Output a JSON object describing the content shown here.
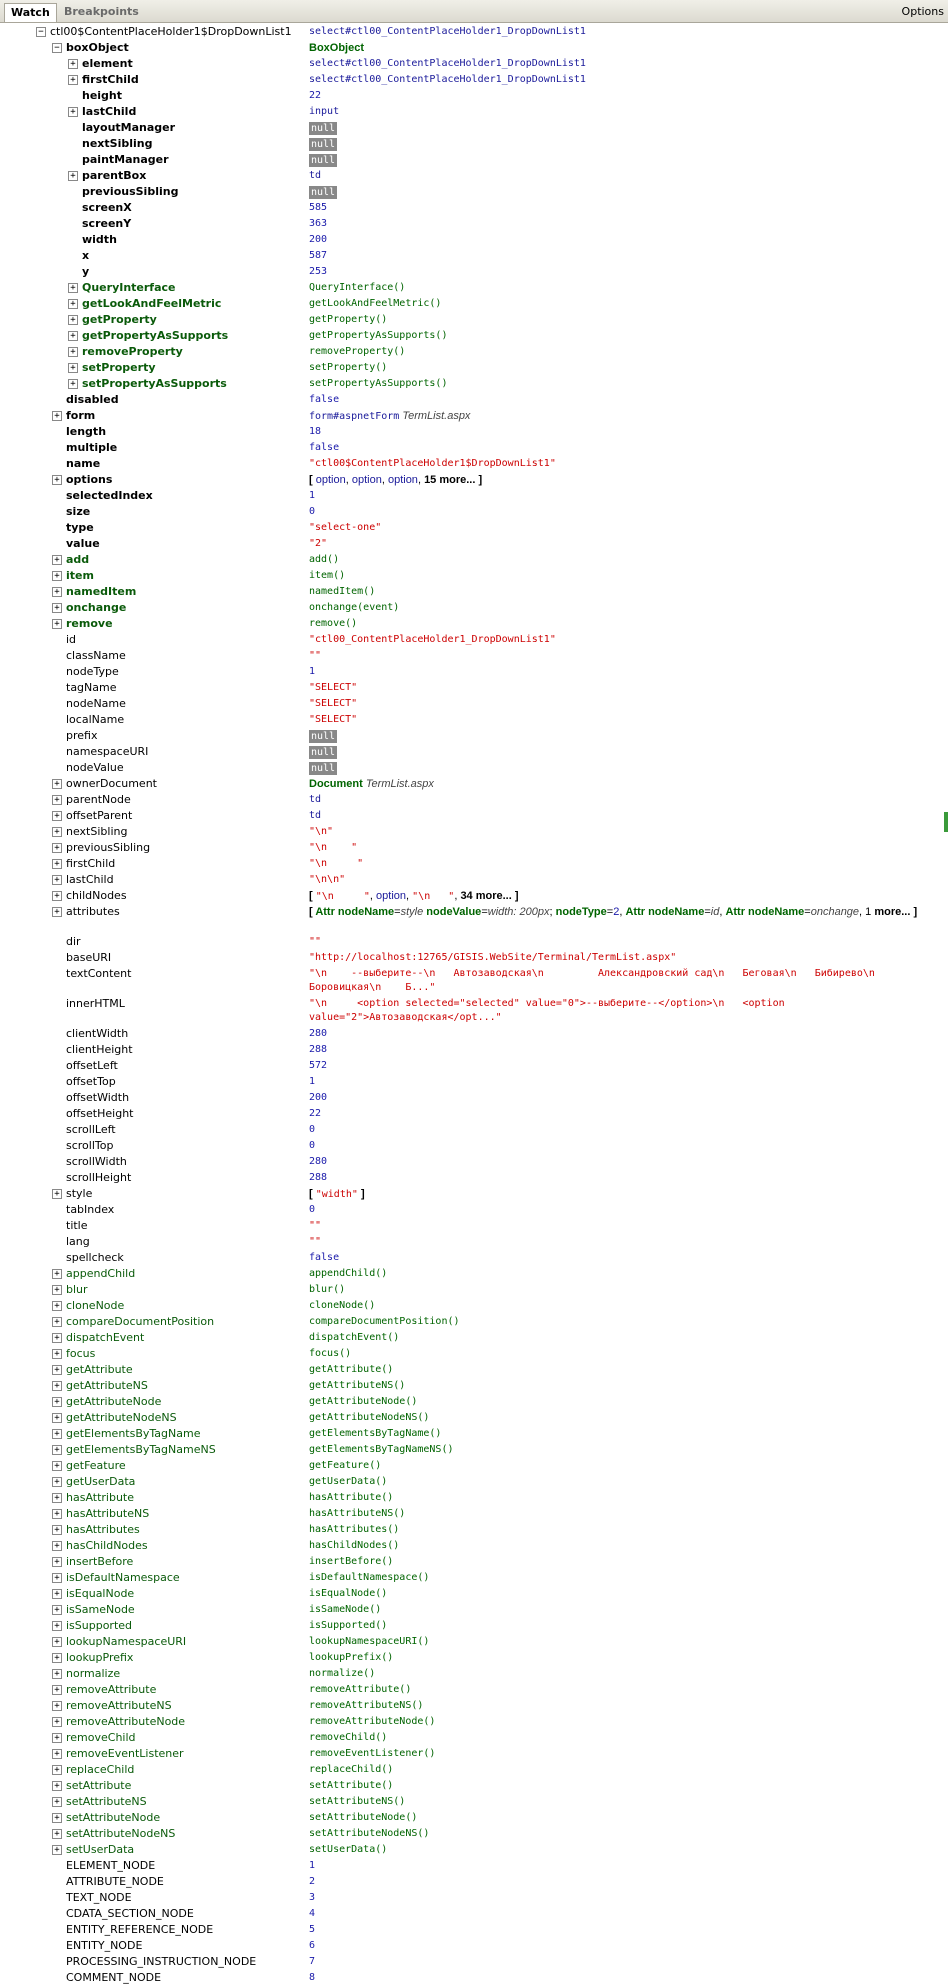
{
  "tabs": {
    "watch": "Watch",
    "breakpoints": "Breakpoints",
    "options": "Options"
  },
  "rows": [
    {
      "d": 0,
      "t": "-",
      "nc": "n-dom",
      "name": "ctl00$ContentPlaceHolder1$DropDownList1",
      "vc": "v-obj",
      "val": "select#ctl00_ContentPlaceHolder1_DropDownList1"
    },
    {
      "d": 1,
      "t": "-",
      "nc": "n-user",
      "name": "boxObject",
      "vc": "v-bold",
      "val": "BoxObject"
    },
    {
      "d": 2,
      "t": "+",
      "nc": "n-user",
      "name": "element",
      "vc": "v-obj",
      "val": "select#ctl00_ContentPlaceHolder1_DropDownList1"
    },
    {
      "d": 2,
      "t": "+",
      "nc": "n-user",
      "name": "firstChild",
      "vc": "v-obj",
      "val": "select#ctl00_ContentPlaceHolder1_DropDownList1"
    },
    {
      "d": 2,
      "t": "",
      "nc": "n-user",
      "name": "height",
      "vc": "v-num",
      "val": "22"
    },
    {
      "d": 2,
      "t": "+",
      "nc": "n-user",
      "name": "lastChild",
      "vc": "v-obj",
      "val": "input"
    },
    {
      "d": 2,
      "t": "",
      "nc": "n-user",
      "name": "layoutManager",
      "vc": "v-null",
      "val": "null"
    },
    {
      "d": 2,
      "t": "",
      "nc": "n-user",
      "name": "nextSibling",
      "vc": "v-null",
      "val": "null"
    },
    {
      "d": 2,
      "t": "",
      "nc": "n-user",
      "name": "paintManager",
      "vc": "v-null",
      "val": "null"
    },
    {
      "d": 2,
      "t": "+",
      "nc": "n-user",
      "name": "parentBox",
      "vc": "v-obj",
      "val": "td"
    },
    {
      "d": 2,
      "t": "",
      "nc": "n-user",
      "name": "previousSibling",
      "vc": "v-null",
      "val": "null"
    },
    {
      "d": 2,
      "t": "",
      "nc": "n-user",
      "name": "screenX",
      "vc": "v-num",
      "val": "585"
    },
    {
      "d": 2,
      "t": "",
      "nc": "n-user",
      "name": "screenY",
      "vc": "v-num",
      "val": "363"
    },
    {
      "d": 2,
      "t": "",
      "nc": "n-user",
      "name": "width",
      "vc": "v-num",
      "val": "200"
    },
    {
      "d": 2,
      "t": "",
      "nc": "n-user",
      "name": "x",
      "vc": "v-num",
      "val": "587"
    },
    {
      "d": 2,
      "t": "",
      "nc": "n-user",
      "name": "y",
      "vc": "v-num",
      "val": "253"
    },
    {
      "d": 2,
      "t": "+",
      "nc": "n-ufunc",
      "name": "QueryInterface",
      "vc": "v-fn",
      "val": "QueryInterface()"
    },
    {
      "d": 2,
      "t": "+",
      "nc": "n-ufunc",
      "name": "getLookAndFeelMetric",
      "vc": "v-fn",
      "val": "getLookAndFeelMetric()"
    },
    {
      "d": 2,
      "t": "+",
      "nc": "n-ufunc",
      "name": "getProperty",
      "vc": "v-fn",
      "val": "getProperty()"
    },
    {
      "d": 2,
      "t": "+",
      "nc": "n-ufunc",
      "name": "getPropertyAsSupports",
      "vc": "v-fn",
      "val": "getPropertyAsSupports()"
    },
    {
      "d": 2,
      "t": "+",
      "nc": "n-ufunc",
      "name": "removeProperty",
      "vc": "v-fn",
      "val": "removeProperty()"
    },
    {
      "d": 2,
      "t": "+",
      "nc": "n-ufunc",
      "name": "setProperty",
      "vc": "v-fn",
      "val": "setProperty()"
    },
    {
      "d": 2,
      "t": "+",
      "nc": "n-ufunc",
      "name": "setPropertyAsSupports",
      "vc": "v-fn",
      "val": "setPropertyAsSupports()"
    },
    {
      "d": 1,
      "t": "",
      "nc": "n-user",
      "name": "disabled",
      "vc": "v-bool",
      "val": "false"
    },
    {
      "d": 1,
      "t": "+",
      "nc": "n-user",
      "name": "form",
      "vc": "v-mixed",
      "val": "form#aspnetForm",
      "extra": "TermList.aspx"
    },
    {
      "d": 1,
      "t": "",
      "nc": "n-user",
      "name": "length",
      "vc": "v-num",
      "val": "18"
    },
    {
      "d": 1,
      "t": "",
      "nc": "n-user",
      "name": "multiple",
      "vc": "v-bool",
      "val": "false"
    },
    {
      "d": 1,
      "t": "",
      "nc": "n-user",
      "name": "name",
      "vc": "v-str",
      "val": "\"ctl00$ContentPlaceHolder1$DropDownList1\""
    },
    {
      "d": 1,
      "t": "+",
      "nc": "n-user",
      "name": "options",
      "vc": "v-arr",
      "arr": "options"
    },
    {
      "d": 1,
      "t": "",
      "nc": "n-user",
      "name": "selectedIndex",
      "vc": "v-num",
      "val": "1"
    },
    {
      "d": 1,
      "t": "",
      "nc": "n-user",
      "name": "size",
      "vc": "v-num",
      "val": "0"
    },
    {
      "d": 1,
      "t": "",
      "nc": "n-user",
      "name": "type",
      "vc": "v-str",
      "val": "\"select-one\""
    },
    {
      "d": 1,
      "t": "",
      "nc": "n-user",
      "name": "value",
      "vc": "v-str",
      "val": "\"2\""
    },
    {
      "d": 1,
      "t": "+",
      "nc": "n-ufunc",
      "name": "add",
      "vc": "v-fn",
      "val": "add()"
    },
    {
      "d": 1,
      "t": "+",
      "nc": "n-ufunc",
      "name": "item",
      "vc": "v-fn",
      "val": "item()"
    },
    {
      "d": 1,
      "t": "+",
      "nc": "n-ufunc",
      "name": "namedItem",
      "vc": "v-fn",
      "val": "namedItem()"
    },
    {
      "d": 1,
      "t": "+",
      "nc": "n-ufunc",
      "name": "onchange",
      "vc": "v-fn",
      "val": "onchange(event)"
    },
    {
      "d": 1,
      "t": "+",
      "nc": "n-ufunc",
      "name": "remove",
      "vc": "v-fn",
      "val": "remove()"
    },
    {
      "d": 1,
      "t": "",
      "nc": "n-prop",
      "name": "id",
      "vc": "v-str",
      "val": "\"ctl00_ContentPlaceHolder1_DropDownList1\""
    },
    {
      "d": 1,
      "t": "",
      "nc": "n-prop",
      "name": "className",
      "vc": "v-str",
      "val": "\"\""
    },
    {
      "d": 1,
      "t": "",
      "nc": "n-prop",
      "name": "nodeType",
      "vc": "v-num",
      "val": "1"
    },
    {
      "d": 1,
      "t": "",
      "nc": "n-prop",
      "name": "tagName",
      "vc": "v-str",
      "val": "\"SELECT\""
    },
    {
      "d": 1,
      "t": "",
      "nc": "n-prop",
      "name": "nodeName",
      "vc": "v-str",
      "val": "\"SELECT\""
    },
    {
      "d": 1,
      "t": "",
      "nc": "n-prop",
      "name": "localName",
      "vc": "v-str",
      "val": "\"SELECT\""
    },
    {
      "d": 1,
      "t": "",
      "nc": "n-prop",
      "name": "prefix",
      "vc": "v-null",
      "val": "null"
    },
    {
      "d": 1,
      "t": "",
      "nc": "n-prop",
      "name": "namespaceURI",
      "vc": "v-null",
      "val": "null"
    },
    {
      "d": 1,
      "t": "",
      "nc": "n-prop",
      "name": "nodeValue",
      "vc": "v-null",
      "val": "null"
    },
    {
      "d": 1,
      "t": "+",
      "nc": "n-prop",
      "name": "ownerDocument",
      "vc": "v-bold-mixed",
      "val": "Document",
      "extra": "TermList.aspx"
    },
    {
      "d": 1,
      "t": "+",
      "nc": "n-prop",
      "name": "parentNode",
      "vc": "v-obj",
      "val": "td"
    },
    {
      "d": 1,
      "t": "+",
      "nc": "n-prop",
      "name": "offsetParent",
      "vc": "v-obj",
      "val": "td"
    },
    {
      "d": 1,
      "t": "+",
      "nc": "n-prop",
      "name": "nextSibling",
      "vc": "v-str",
      "val": "\"\\n\""
    },
    {
      "d": 1,
      "t": "+",
      "nc": "n-prop",
      "name": "previousSibling",
      "vc": "v-str",
      "val": "\"\\n    \""
    },
    {
      "d": 1,
      "t": "+",
      "nc": "n-prop",
      "name": "firstChild",
      "vc": "v-str",
      "val": "\"\\n     \""
    },
    {
      "d": 1,
      "t": "+",
      "nc": "n-prop",
      "name": "lastChild",
      "vc": "v-str",
      "val": "\"\\n\\n\""
    },
    {
      "d": 1,
      "t": "+",
      "nc": "n-prop",
      "name": "childNodes",
      "vc": "v-arr",
      "arr": "childNodes"
    },
    {
      "d": 1,
      "t": "+",
      "nc": "n-prop",
      "name": "attributes",
      "vc": "v-arr",
      "arr": "attributes",
      "h2": true
    },
    {
      "d": 1,
      "t": "",
      "nc": "n-prop",
      "name": "dir",
      "vc": "v-str",
      "val": "\"\""
    },
    {
      "d": 1,
      "t": "",
      "nc": "n-prop",
      "name": "baseURI",
      "vc": "v-str",
      "val": "\"http://localhost:12765/GISIS.WebSite/Terminal/TermList.aspx\""
    },
    {
      "d": 1,
      "t": "",
      "nc": "n-prop",
      "name": "textContent",
      "vc": "v-str",
      "val": "\"\\n    --выберите--\\n   Автозаводская\\n         Александровский сад\\n   Беговая\\n   Бибирево\\n       Боровицкая\\n    Б...\"",
      "h2": true
    },
    {
      "d": 1,
      "t": "",
      "nc": "n-prop",
      "name": "innerHTML",
      "vc": "v-str",
      "val": "\"\\n     <option selected=\"selected\" value=\"0\">--выберите--</option>\\n   <option value=\"2\">Автозаводская</opt...\"",
      "h2": true
    },
    {
      "d": 1,
      "t": "",
      "nc": "n-prop",
      "name": "clientWidth",
      "vc": "v-num",
      "val": "280"
    },
    {
      "d": 1,
      "t": "",
      "nc": "n-prop",
      "name": "clientHeight",
      "vc": "v-num",
      "val": "288"
    },
    {
      "d": 1,
      "t": "",
      "nc": "n-prop",
      "name": "offsetLeft",
      "vc": "v-num",
      "val": "572"
    },
    {
      "d": 1,
      "t": "",
      "nc": "n-prop",
      "name": "offsetTop",
      "vc": "v-num",
      "val": "1"
    },
    {
      "d": 1,
      "t": "",
      "nc": "n-prop",
      "name": "offsetWidth",
      "vc": "v-num",
      "val": "200"
    },
    {
      "d": 1,
      "t": "",
      "nc": "n-prop",
      "name": "offsetHeight",
      "vc": "v-num",
      "val": "22"
    },
    {
      "d": 1,
      "t": "",
      "nc": "n-prop",
      "name": "scrollLeft",
      "vc": "v-num",
      "val": "0"
    },
    {
      "d": 1,
      "t": "",
      "nc": "n-prop",
      "name": "scrollTop",
      "vc": "v-num",
      "val": "0"
    },
    {
      "d": 1,
      "t": "",
      "nc": "n-prop",
      "name": "scrollWidth",
      "vc": "v-num",
      "val": "280"
    },
    {
      "d": 1,
      "t": "",
      "nc": "n-prop",
      "name": "scrollHeight",
      "vc": "v-num",
      "val": "288"
    },
    {
      "d": 1,
      "t": "+",
      "nc": "n-prop",
      "name": "style",
      "vc": "v-arr",
      "arr": "style"
    },
    {
      "d": 1,
      "t": "",
      "nc": "n-prop",
      "name": "tabIndex",
      "vc": "v-num",
      "val": "0"
    },
    {
      "d": 1,
      "t": "",
      "nc": "n-prop",
      "name": "title",
      "vc": "v-str",
      "val": "\"\""
    },
    {
      "d": 1,
      "t": "",
      "nc": "n-prop",
      "name": "lang",
      "vc": "v-str",
      "val": "\"\""
    },
    {
      "d": 1,
      "t": "",
      "nc": "n-prop",
      "name": "spellcheck",
      "vc": "v-bool",
      "val": "false"
    },
    {
      "d": 1,
      "t": "+",
      "nc": "n-func",
      "name": "appendChild",
      "vc": "v-fn",
      "val": "appendChild()"
    },
    {
      "d": 1,
      "t": "+",
      "nc": "n-func",
      "name": "blur",
      "vc": "v-fn",
      "val": "blur()"
    },
    {
      "d": 1,
      "t": "+",
      "nc": "n-func",
      "name": "cloneNode",
      "vc": "v-fn",
      "val": "cloneNode()"
    },
    {
      "d": 1,
      "t": "+",
      "nc": "n-func",
      "name": "compareDocumentPosition",
      "vc": "v-fn",
      "val": "compareDocumentPosition()"
    },
    {
      "d": 1,
      "t": "+",
      "nc": "n-func",
      "name": "dispatchEvent",
      "vc": "v-fn",
      "val": "dispatchEvent()"
    },
    {
      "d": 1,
      "t": "+",
      "nc": "n-func",
      "name": "focus",
      "vc": "v-fn",
      "val": "focus()"
    },
    {
      "d": 1,
      "t": "+",
      "nc": "n-func",
      "name": "getAttribute",
      "vc": "v-fn",
      "val": "getAttribute()"
    },
    {
      "d": 1,
      "t": "+",
      "nc": "n-func",
      "name": "getAttributeNS",
      "vc": "v-fn",
      "val": "getAttributeNS()"
    },
    {
      "d": 1,
      "t": "+",
      "nc": "n-func",
      "name": "getAttributeNode",
      "vc": "v-fn",
      "val": "getAttributeNode()"
    },
    {
      "d": 1,
      "t": "+",
      "nc": "n-func",
      "name": "getAttributeNodeNS",
      "vc": "v-fn",
      "val": "getAttributeNodeNS()"
    },
    {
      "d": 1,
      "t": "+",
      "nc": "n-func",
      "name": "getElementsByTagName",
      "vc": "v-fn",
      "val": "getElementsByTagName()"
    },
    {
      "d": 1,
      "t": "+",
      "nc": "n-func",
      "name": "getElementsByTagNameNS",
      "vc": "v-fn",
      "val": "getElementsByTagNameNS()"
    },
    {
      "d": 1,
      "t": "+",
      "nc": "n-func",
      "name": "getFeature",
      "vc": "v-fn",
      "val": "getFeature()"
    },
    {
      "d": 1,
      "t": "+",
      "nc": "n-func",
      "name": "getUserData",
      "vc": "v-fn",
      "val": "getUserData()"
    },
    {
      "d": 1,
      "t": "+",
      "nc": "n-func",
      "name": "hasAttribute",
      "vc": "v-fn",
      "val": "hasAttribute()"
    },
    {
      "d": 1,
      "t": "+",
      "nc": "n-func",
      "name": "hasAttributeNS",
      "vc": "v-fn",
      "val": "hasAttributeNS()"
    },
    {
      "d": 1,
      "t": "+",
      "nc": "n-func",
      "name": "hasAttributes",
      "vc": "v-fn",
      "val": "hasAttributes()"
    },
    {
      "d": 1,
      "t": "+",
      "nc": "n-func",
      "name": "hasChildNodes",
      "vc": "v-fn",
      "val": "hasChildNodes()"
    },
    {
      "d": 1,
      "t": "+",
      "nc": "n-func",
      "name": "insertBefore",
      "vc": "v-fn",
      "val": "insertBefore()"
    },
    {
      "d": 1,
      "t": "+",
      "nc": "n-func",
      "name": "isDefaultNamespace",
      "vc": "v-fn",
      "val": "isDefaultNamespace()"
    },
    {
      "d": 1,
      "t": "+",
      "nc": "n-func",
      "name": "isEqualNode",
      "vc": "v-fn",
      "val": "isEqualNode()"
    },
    {
      "d": 1,
      "t": "+",
      "nc": "n-func",
      "name": "isSameNode",
      "vc": "v-fn",
      "val": "isSameNode()"
    },
    {
      "d": 1,
      "t": "+",
      "nc": "n-func",
      "name": "isSupported",
      "vc": "v-fn",
      "val": "isSupported()"
    },
    {
      "d": 1,
      "t": "+",
      "nc": "n-func",
      "name": "lookupNamespaceURI",
      "vc": "v-fn",
      "val": "lookupNamespaceURI()"
    },
    {
      "d": 1,
      "t": "+",
      "nc": "n-func",
      "name": "lookupPrefix",
      "vc": "v-fn",
      "val": "lookupPrefix()"
    },
    {
      "d": 1,
      "t": "+",
      "nc": "n-func",
      "name": "normalize",
      "vc": "v-fn",
      "val": "normalize()"
    },
    {
      "d": 1,
      "t": "+",
      "nc": "n-func",
      "name": "removeAttribute",
      "vc": "v-fn",
      "val": "removeAttribute()"
    },
    {
      "d": 1,
      "t": "+",
      "nc": "n-func",
      "name": "removeAttributeNS",
      "vc": "v-fn",
      "val": "removeAttributeNS()"
    },
    {
      "d": 1,
      "t": "+",
      "nc": "n-func",
      "name": "removeAttributeNode",
      "vc": "v-fn",
      "val": "removeAttributeNode()"
    },
    {
      "d": 1,
      "t": "+",
      "nc": "n-func",
      "name": "removeChild",
      "vc": "v-fn",
      "val": "removeChild()"
    },
    {
      "d": 1,
      "t": "+",
      "nc": "n-func",
      "name": "removeEventListener",
      "vc": "v-fn",
      "val": "removeEventListener()"
    },
    {
      "d": 1,
      "t": "+",
      "nc": "n-func",
      "name": "replaceChild",
      "vc": "v-fn",
      "val": "replaceChild()"
    },
    {
      "d": 1,
      "t": "+",
      "nc": "n-func",
      "name": "setAttribute",
      "vc": "v-fn",
      "val": "setAttribute()"
    },
    {
      "d": 1,
      "t": "+",
      "nc": "n-func",
      "name": "setAttributeNS",
      "vc": "v-fn",
      "val": "setAttributeNS()"
    },
    {
      "d": 1,
      "t": "+",
      "nc": "n-func",
      "name": "setAttributeNode",
      "vc": "v-fn",
      "val": "setAttributeNode()"
    },
    {
      "d": 1,
      "t": "+",
      "nc": "n-func",
      "name": "setAttributeNodeNS",
      "vc": "v-fn",
      "val": "setAttributeNodeNS()"
    },
    {
      "d": 1,
      "t": "+",
      "nc": "n-func",
      "name": "setUserData",
      "vc": "v-fn",
      "val": "setUserData()"
    },
    {
      "d": 1,
      "t": "",
      "nc": "n-prop",
      "name": "ELEMENT_NODE",
      "vc": "v-num",
      "val": "1"
    },
    {
      "d": 1,
      "t": "",
      "nc": "n-prop",
      "name": "ATTRIBUTE_NODE",
      "vc": "v-num",
      "val": "2"
    },
    {
      "d": 1,
      "t": "",
      "nc": "n-prop",
      "name": "TEXT_NODE",
      "vc": "v-num",
      "val": "3"
    },
    {
      "d": 1,
      "t": "",
      "nc": "n-prop",
      "name": "CDATA_SECTION_NODE",
      "vc": "v-num",
      "val": "4"
    },
    {
      "d": 1,
      "t": "",
      "nc": "n-prop",
      "name": "ENTITY_REFERENCE_NODE",
      "vc": "v-num",
      "val": "5"
    },
    {
      "d": 1,
      "t": "",
      "nc": "n-prop",
      "name": "ENTITY_NODE",
      "vc": "v-num",
      "val": "6"
    },
    {
      "d": 1,
      "t": "",
      "nc": "n-prop",
      "name": "PROCESSING_INSTRUCTION_NODE",
      "vc": "v-num",
      "val": "7"
    },
    {
      "d": 1,
      "t": "",
      "nc": "n-prop",
      "name": "COMMENT_NODE",
      "vc": "v-num",
      "val": "8"
    }
  ],
  "arrays": {
    "options": [
      [
        "o",
        "option"
      ],
      [
        "p",
        ", "
      ],
      [
        "o",
        "option"
      ],
      [
        "p",
        ", "
      ],
      [
        "o",
        "option"
      ],
      [
        "p",
        ", "
      ],
      [
        "t",
        "15 more..."
      ]
    ],
    "childNodes": [
      [
        "s",
        "\"\\n     \""
      ],
      [
        "p",
        ", "
      ],
      [
        "o",
        "option"
      ],
      [
        "p",
        ", "
      ],
      [
        "s",
        "\"\\n   \""
      ],
      [
        "p",
        ", "
      ],
      [
        "t",
        "34 more..."
      ]
    ],
    "attributes": [
      [
        "b",
        "Attr nodeName"
      ],
      [
        "p",
        "="
      ],
      [
        "i",
        "style"
      ],
      [
        "p",
        " "
      ],
      [
        "b",
        "nodeValue"
      ],
      [
        "p",
        "="
      ],
      [
        "i",
        "width: 200px"
      ],
      [
        "p",
        "; "
      ],
      [
        "b",
        "nodeType"
      ],
      [
        "p",
        "="
      ],
      [
        "n",
        "2"
      ],
      [
        "p",
        ", "
      ],
      [
        "b",
        "Attr nodeName"
      ],
      [
        "p",
        "="
      ],
      [
        "i",
        "id"
      ],
      [
        "p",
        ", "
      ],
      [
        "b",
        "Attr nodeName"
      ],
      [
        "p",
        "="
      ],
      [
        "i",
        "onchange"
      ],
      [
        "p",
        ", 1 "
      ],
      [
        "t",
        "more..."
      ]
    ],
    "style": [
      [
        "s",
        "\"width\""
      ]
    ]
  }
}
